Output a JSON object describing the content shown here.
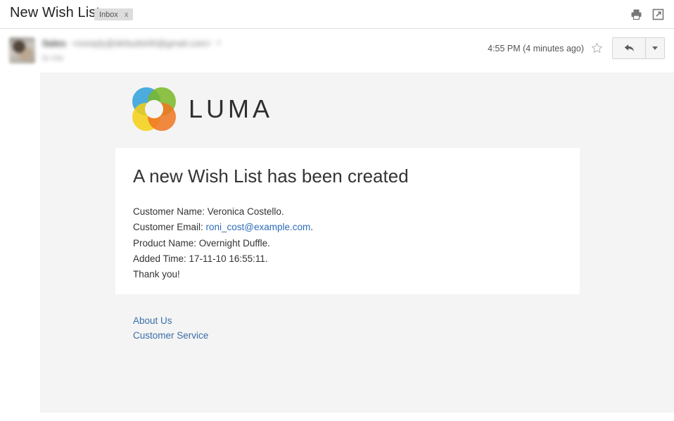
{
  "header": {
    "subject": "New Wish List",
    "label": "Inbox",
    "label_remove": "x",
    "print_icon": "print-icon",
    "popout_icon": "open-in-new-window-icon"
  },
  "message": {
    "sender_name": "Sales",
    "sender_email": "<noreply@defaultshl0@gmail.com>",
    "sender_caret": "▾",
    "recipient_line": "to me",
    "timestamp": "4:55 PM (4 minutes ago)",
    "star_icon": "star-outline-icon",
    "reply_icon": "reply-arrow-icon",
    "more_icon": "chevron-down-icon"
  },
  "email": {
    "brand": {
      "wordmark": "LUMA",
      "logo_colors": {
        "blue": "#2f9fd8",
        "green": "#7ab828",
        "yellow": "#f5cf13",
        "orange": "#ef7622"
      }
    },
    "card": {
      "heading": "A new Wish List has been created",
      "lines": [
        {
          "label": "Customer Name: ",
          "value": "Veronica Costello."
        },
        {
          "label": "Customer Email: ",
          "link": "roni_cost@example.com",
          "suffix": "."
        },
        {
          "label": "Product Name: ",
          "value": "Overnight Duffle."
        },
        {
          "label": "Added Time: ",
          "value": "17-11-10 16:55:11."
        },
        {
          "label": "Thank you!",
          "value": ""
        }
      ]
    },
    "footer": {
      "links": [
        "About Us",
        "Customer Service"
      ],
      "link_color": "#3a6ea8"
    },
    "background": "#f4f4f4",
    "card_background": "#ffffff"
  }
}
